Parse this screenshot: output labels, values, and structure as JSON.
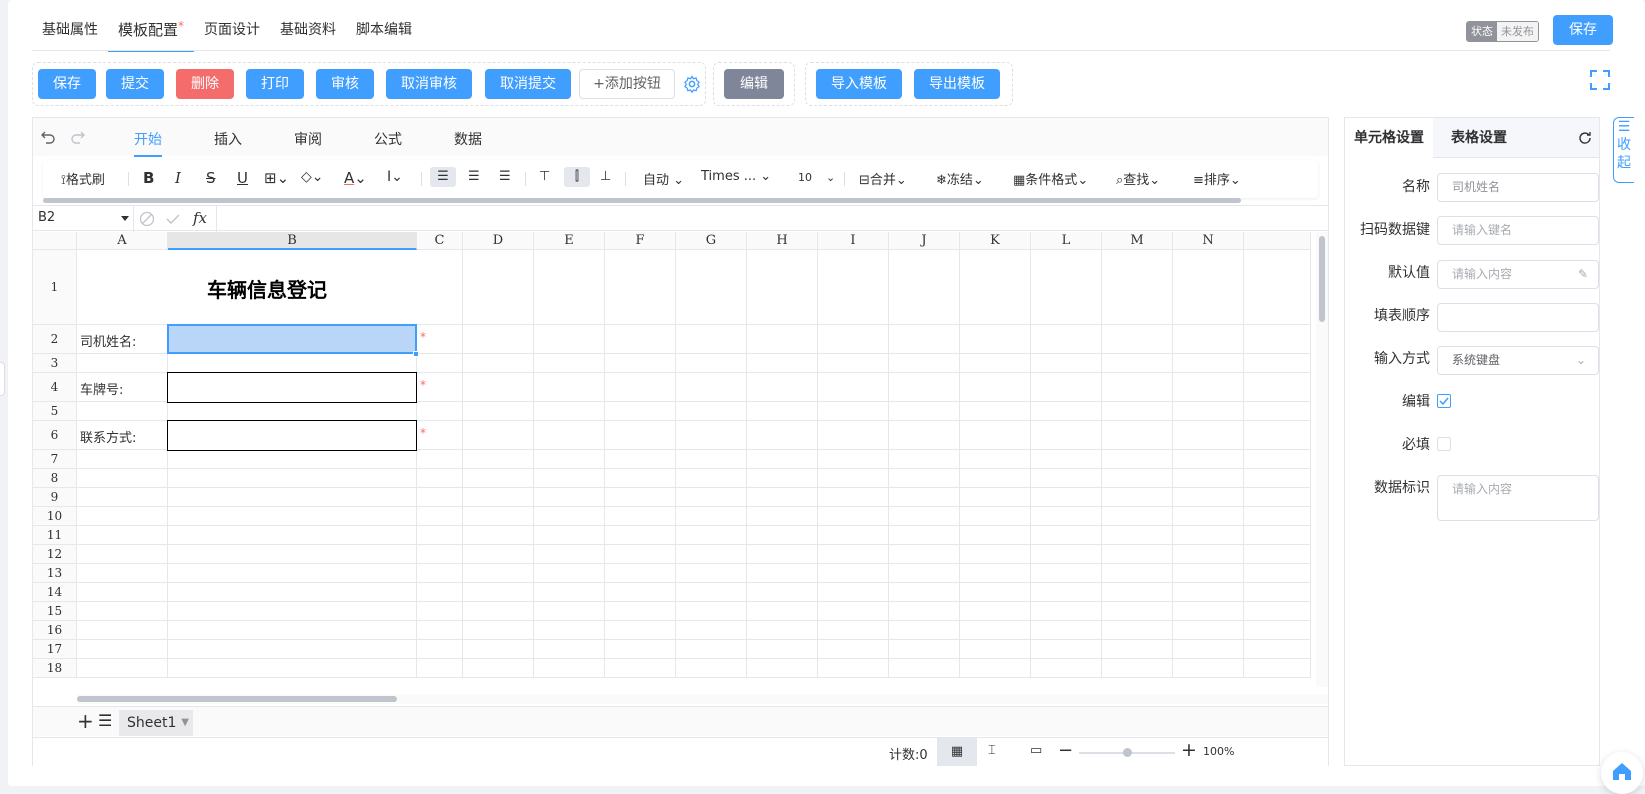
{
  "top_tabs": [
    {
      "label": "基础属性",
      "required": false
    },
    {
      "label": "模板配置",
      "required": true
    },
    {
      "label": "页面设计",
      "required": false
    },
    {
      "label": "基础资料",
      "required": false
    },
    {
      "label": "脚本编辑",
      "required": false
    }
  ],
  "required_mark": "*",
  "status": {
    "label": "状态",
    "value": "未发布"
  },
  "top_save_label": "保存",
  "toolbar": {
    "save": "保存",
    "submit": "提交",
    "delete": "删除",
    "print": "打印",
    "audit": "审核",
    "cancel_audit": "取消审核",
    "cancel_submit": "取消提交",
    "add_button": "+添加按钮",
    "edit": "编辑",
    "import_template": "导入模板",
    "export_template": "导出模板"
  },
  "menu": {
    "start": "开始",
    "insert": "插入",
    "review": "审阅",
    "formula": "公式",
    "data": "数据"
  },
  "ribbon": {
    "format_painter": "格式刷",
    "bold": "B",
    "italic": "I",
    "strike": "S",
    "underline": "U",
    "font_color": "A",
    "wrap": "自动",
    "font_name": "Times ...",
    "font_size": "10",
    "merge": "合并",
    "freeze": "冻结",
    "cond_format": "条件格式",
    "find": "查找",
    "sort": "排序"
  },
  "formula_bar": {
    "cell_ref": "B2",
    "fx": "fx"
  },
  "columns": [
    "A",
    "B",
    "C",
    "D",
    "E",
    "F",
    "G",
    "H",
    "I",
    "J",
    "K",
    "L",
    "M",
    "N"
  ],
  "rows": [
    "1",
    "2",
    "3",
    "4",
    "5",
    "6",
    "7",
    "8",
    "9",
    "10",
    "11",
    "12",
    "13",
    "14",
    "15",
    "16",
    "17",
    "18"
  ],
  "cells": {
    "title": "车辆信息登记",
    "driver_name_label": "司机姓名:",
    "plate_label": "车牌号:",
    "contact_label": "联系方式:"
  },
  "sheet_tab": "Sheet1",
  "status_bar": {
    "count": "计数:0",
    "zoom": "100%",
    "zoom_level": 1.0
  },
  "panel": {
    "tab_cell": "单元格设置",
    "tab_table": "表格设置",
    "fields": {
      "name_label": "名称",
      "name_value": "司机姓名",
      "scan_label": "扫码数据键",
      "scan_placeholder": "请输入键名",
      "default_label": "默认值",
      "default_placeholder": "请输入内容",
      "order_label": "填表顺序",
      "order_value": "",
      "input_label": "输入方式",
      "input_value": "系统键盘",
      "edit_label": "编辑",
      "edit_checked": true,
      "required_label": "必填",
      "required_checked": false,
      "data_tag_label": "数据标识",
      "data_tag_placeholder": "请输入内容"
    }
  },
  "collapse_label": "收起",
  "colors": {
    "primary": "#409eff",
    "danger": "#f56c6c",
    "muted": "#7f8699"
  }
}
